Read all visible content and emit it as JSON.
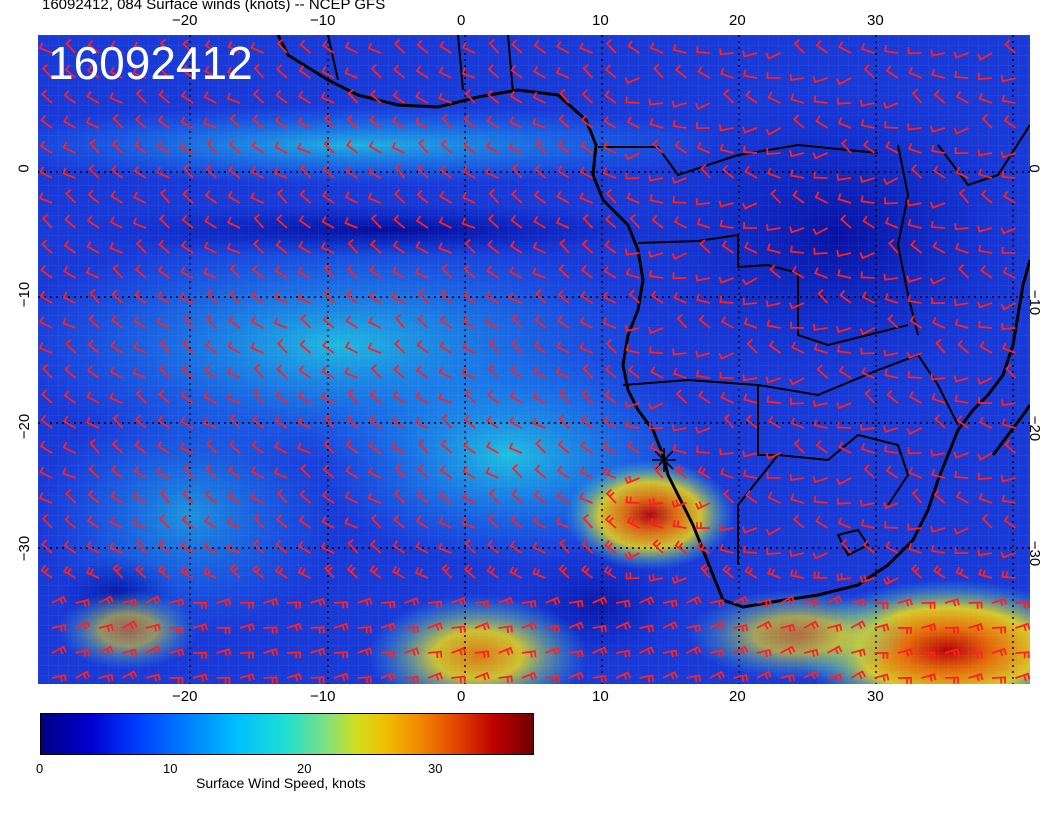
{
  "title": "16092412, 084 Surface winds (knots) -- NCEP GFS",
  "stamp": "16092412",
  "map": {
    "lon_range": [
      -30,
      40
    ],
    "lat_range": [
      -40,
      5
    ],
    "top_lon_labels": [
      "−20",
      "−10",
      "0",
      "10",
      "20",
      "30"
    ],
    "bottom_lon_labels": [
      "−20",
      "−10",
      "0",
      "10",
      "20",
      "30"
    ],
    "lat_labels": [
      "0",
      "−10",
      "−20",
      "−30"
    ],
    "barb_color": "#ff2020",
    "coast_color": "#000000"
  },
  "colorbar": {
    "title": "Surface Wind Speed, knots",
    "ticks": [
      "0",
      "10",
      "20",
      "30"
    ],
    "range": [
      0,
      37
    ]
  }
}
